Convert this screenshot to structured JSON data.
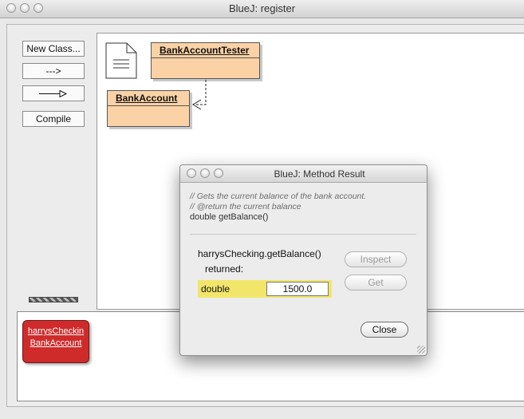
{
  "window": {
    "title": "BlueJ:  register"
  },
  "toolbar": {
    "new_class_label": "New Class...",
    "dependency_arrow_label": "--->",
    "compile_label": "Compile"
  },
  "diagram": {
    "classes": [
      {
        "name": "BankAccountTester"
      },
      {
        "name": "BankAccount"
      }
    ]
  },
  "object_bench": {
    "objects": [
      {
        "name": "harrysCheckin",
        "type": "BankAccount"
      }
    ]
  },
  "dialog": {
    "title": "BlueJ:  Method Result",
    "comment_lines": [
      "// Gets the current balance of the bank account.",
      "// @return the current balance"
    ],
    "signature": "double getBalance()",
    "call": "harrysChecking.getBalance()",
    "returned_label": "returned:",
    "result_type": "double",
    "result_value": "1500.0",
    "inspect_label": "Inspect",
    "get_label": "Get",
    "close_label": "Close"
  },
  "colors": {
    "class_fill": "#fbd2a5",
    "object_fill": "#cf2b2b",
    "result_highlight": "#f2e66a"
  }
}
